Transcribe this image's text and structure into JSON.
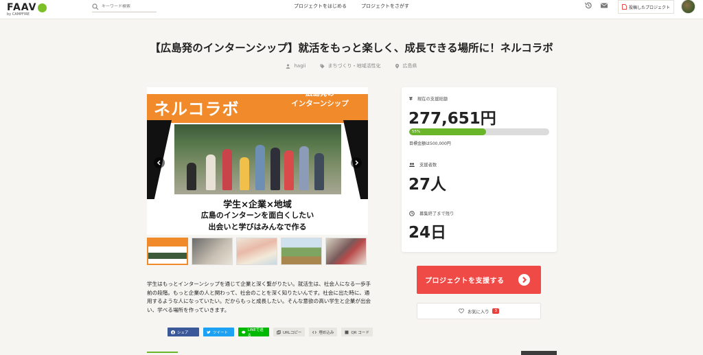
{
  "header": {
    "logo": "FAAVO",
    "logo_sub": "by CAMPFIRE",
    "search_placeholder": "キーワード検索",
    "nav": [
      "プロジェクトをはじめる",
      "プロジェクトをさがす"
    ],
    "my_projects_label": "投稿したプロジェクト",
    "icons": [
      "search-icon",
      "history-icon",
      "mail-icon",
      "document-icon",
      "avatar"
    ]
  },
  "project": {
    "title": "【広島発のインターンシップ】就活をもっと楽しく、成長できる場所に！ネルコラボ",
    "owner": "hagii",
    "category": "まちづくり・地域活性化",
    "location": "広島県"
  },
  "hero": {
    "main_text": "ネルコラボ",
    "sub_text_1": "広島発の",
    "sub_text_2": "インターンシップ",
    "caption_1": "学生×企業×地域",
    "caption_2": "広島のインターンを面白くしたい",
    "caption_3": "出会いと学びはみんなで作る",
    "thumbnail_count": 5
  },
  "description": "学生はもっとインターンシップを通じて企業と深く繋がりたい。就活生は、社会人になる一歩手前の段階。もっと企業の人と関わって、社会のことを深く知りたいんです。社会に出た時に、通用するような人になっていたい。だからもっと成長したい。そんな意欲の高い学生と企業が出会い、学べる場所を作っていきます。",
  "share": {
    "facebook": "シェア",
    "twitter": "ツイート",
    "line": "LINEで送る",
    "url_copy": "URLコピー",
    "embed": "埋め込み",
    "qr": "QR コード"
  },
  "stats": {
    "raised_label": "現在の支援総額",
    "raised_value": "277,651円",
    "progress_percent": 55,
    "progress_text": "55%",
    "goal_text": "目標金額は500,000円",
    "backers_label": "支援者数",
    "backers_value": "27人",
    "remaining_label": "募集終了まで残り",
    "remaining_value": "24日"
  },
  "actions": {
    "support_label": "プロジェクトを支援する",
    "favorite_label": "お気に入り",
    "favorite_count": "3"
  },
  "colors": {
    "accent_red": "#ef4a46",
    "progress_green": "#6bb52b",
    "hero_orange": "#f08a2a",
    "background": "#f6f5f1"
  }
}
